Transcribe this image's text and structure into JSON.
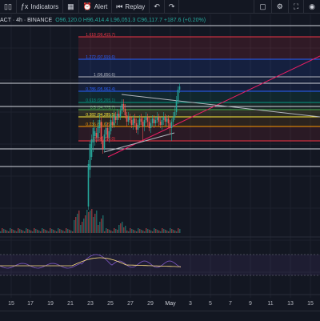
{
  "toolbar": {
    "indicators_label": "Indicators",
    "alert_label": "Alert",
    "replay_label": "Replay",
    "icons": [
      "candles-icon",
      "indicators-icon",
      "templates-icon",
      "alert-icon",
      "replay-icon",
      "undo-icon",
      "redo-icon",
      "layout-icon",
      "settings-icon",
      "fullscreen-icon",
      "camera-icon"
    ]
  },
  "legend": {
    "symbol": "ACT · 4h · BINANCE",
    "ohlc": "O96,120.0 H96,414.4 L96,051.3 C96,117.7 +187.6 (+0.20%)"
  },
  "fib_levels": [
    {
      "ratio": "1.618",
      "price": "99,415.7",
      "label": "1.618 (99,415.7)",
      "color": "#f23645"
    },
    {
      "ratio": "1.272",
      "price": "97,919.6",
      "label": "1.272 (97,919.6)",
      "color": "#2962ff"
    },
    {
      "ratio": "1",
      "price": "96,850.6",
      "label": "1 (96,850.6)",
      "color": "#b2b5be"
    },
    {
      "ratio": "0.786",
      "price": "95,962.4",
      "label": "0.786 (95,962.4)",
      "color": "#2962ff"
    },
    {
      "ratio": "0.618",
      "price": "95,265.1",
      "label": "0.618 (95,265.1)",
      "color": "#089981"
    },
    {
      "ratio": "0.5",
      "price": "94,775.7",
      "label": "0.5 (94,775.7)",
      "color": "#4caf50"
    },
    {
      "ratio": "0.382",
      "price": "94,285.5",
      "label": "0.382 (94,285.5)",
      "color": "#ffeb3b"
    },
    {
      "ratio": "0.236",
      "price": "93,679.0",
      "label": "0.236 (93,679.0)",
      "color": "#ff9800"
    },
    {
      "ratio": "0",
      "price": "92,700.0",
      "label": "0 (92,700.0)",
      "color": "#f23645"
    }
  ],
  "dates": [
    "15",
    "17",
    "19",
    "21",
    "23",
    "25",
    "27",
    "29",
    "May",
    "3",
    "5",
    "7",
    "9",
    "11",
    "13",
    "15"
  ],
  "colors": {
    "background": "#131722",
    "up": "#26a69a",
    "down": "#ef5350",
    "grid": "#1e222d"
  }
}
